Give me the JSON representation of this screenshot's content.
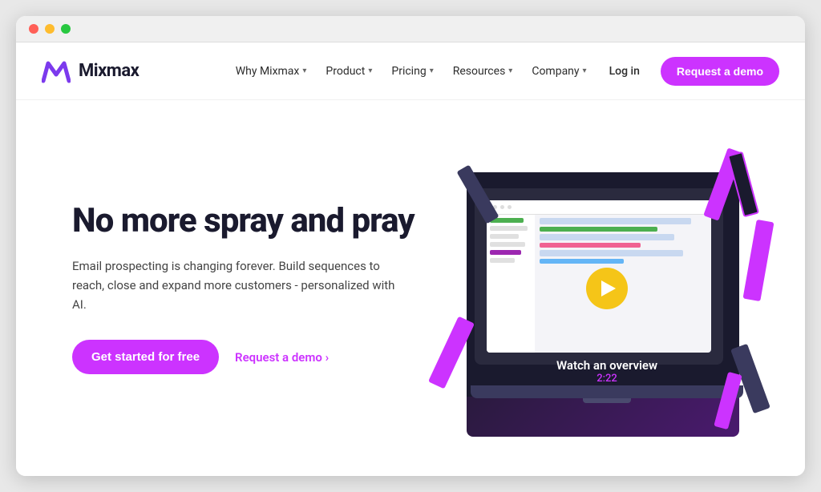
{
  "browser": {
    "title": "Mixmax"
  },
  "navbar": {
    "logo_text": "Mixmax",
    "nav_items": [
      {
        "label": "Why Mixmax",
        "has_dropdown": true
      },
      {
        "label": "Product",
        "has_dropdown": true
      },
      {
        "label": "Pricing",
        "has_dropdown": true
      },
      {
        "label": "Resources",
        "has_dropdown": true
      },
      {
        "label": "Company",
        "has_dropdown": true
      }
    ],
    "login_label": "Log in",
    "cta_label": "Request a demo"
  },
  "hero": {
    "title": "No more spray and pray",
    "subtitle": "Email prospecting is changing forever. Build sequences to reach, close and expand more customers - personalized with AI.",
    "cta_primary": "Get started for free",
    "cta_secondary": "Request a demo ›",
    "video": {
      "label": "Watch an overview",
      "duration": "2:22"
    }
  },
  "colors": {
    "purple": "#cc33ff",
    "dark_navy": "#1a1a2e",
    "yellow": "#f5c518"
  }
}
